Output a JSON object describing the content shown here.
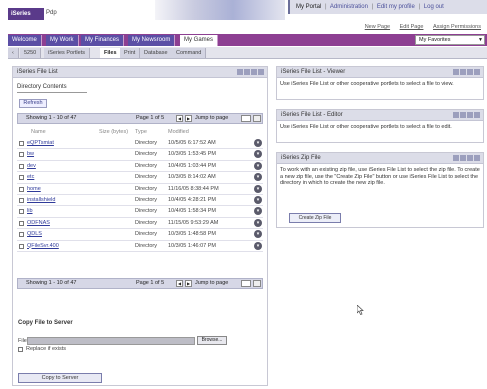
{
  "header": {
    "logo": "iSeries",
    "logo_suffix": "Pdp",
    "portal_title": "My Portal",
    "links": [
      "Administration",
      "Edit my profile",
      "Log out"
    ],
    "sub_links": [
      "New Page",
      "Edit Page",
      "Assign Permissions"
    ]
  },
  "tabs": [
    {
      "label": "Welcome",
      "active": false
    },
    {
      "label": "My Work",
      "active": false
    },
    {
      "label": "My Finances",
      "active": false
    },
    {
      "label": "My Newsroom",
      "active": false
    },
    {
      "label": "My Games",
      "active": true
    }
  ],
  "favorites": {
    "value": "My Favorites"
  },
  "subtabs": [
    {
      "label": "5250",
      "active": false
    },
    {
      "label": "iSeries Portlets",
      "active": false
    },
    {
      "label": "Files",
      "active": true
    },
    {
      "label": "Print",
      "active": false
    },
    {
      "label": "Database",
      "active": false
    },
    {
      "label": "Command",
      "active": false
    }
  ],
  "file_list": {
    "title": "iSeries File List",
    "directory_contents": "Directory Contents",
    "refresh": "Refresh",
    "pager": {
      "showing": "Showing 1 - 10 of 47",
      "page": "Page 1 of 5",
      "jump": "Jump to page"
    },
    "columns": {
      "name": "Name",
      "size": "Size (bytes)",
      "type": "Type",
      "modified": "Modified"
    },
    "rows": [
      {
        "name": "eQPTsmiat",
        "type": "Directory",
        "modified": "10/5/05 6:17:52 AM"
      },
      {
        "name": "bw",
        "type": "Directory",
        "modified": "10/3/05 1:53:45 PM"
      },
      {
        "name": "dev",
        "type": "Directory",
        "modified": "10/4/05 1:03:44 PM"
      },
      {
        "name": "etc",
        "type": "Directory",
        "modified": "10/3/05 8:14:02 AM"
      },
      {
        "name": "home",
        "type": "Directory",
        "modified": "11/16/05 8:38:44 PM"
      },
      {
        "name": "installshield",
        "type": "Directory",
        "modified": "10/4/05 4:28:21 PM"
      },
      {
        "name": "lib",
        "type": "Directory",
        "modified": "10/4/05 1:58:34 PM"
      },
      {
        "name": "ODFNAS",
        "type": "Directory",
        "modified": "11/15/05 9:53:29 AM"
      },
      {
        "name": "QDLS",
        "type": "Directory",
        "modified": "10/3/05 1:48:58 PM"
      },
      {
        "name": "QFileSvr.400",
        "type": "Directory",
        "modified": "10/3/05 1:46:07 PM"
      }
    ],
    "copy_title": "Copy File to Server",
    "file_label": "File:",
    "browse": "Browse...",
    "replace_label": "Replace if exists",
    "copy_button": "Copy to Server"
  },
  "viewer": {
    "title": "iSeries File List - Viewer",
    "text": "Use iSeries File List or other cooperative portlets to select a file to view."
  },
  "editor": {
    "title": "iSeries File List - Editor",
    "text": "Use iSeries File List or other cooperative portlets to select a file to edit."
  },
  "zip": {
    "title": "iSeries Zip File",
    "text": "To work with an existing zip file, use iSeries File List to select the zip file. To create a new zip file, use the \"Create Zip File\" button or use iSeries File List to select the directory in which to create the new zip file.",
    "button": "Create Zip File"
  }
}
